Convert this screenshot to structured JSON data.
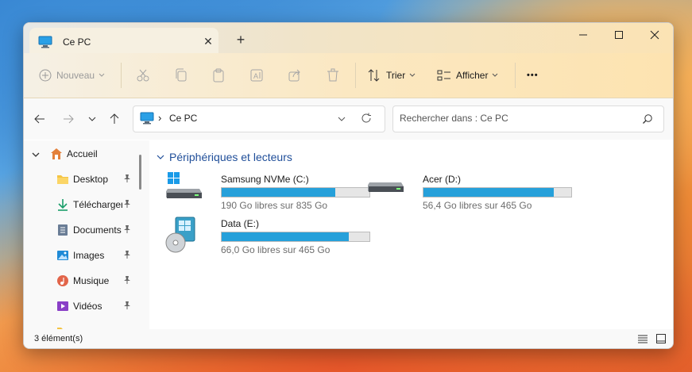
{
  "window": {
    "tab_title": "Ce PC",
    "new_tab": "+",
    "close_tab": "✕"
  },
  "toolbar": {
    "new_label": "Nouveau",
    "sort_label": "Trier",
    "view_label": "Afficher",
    "more_label": "•••"
  },
  "nav": {
    "breadcrumb_sep": "›",
    "location": "Ce PC",
    "search_placeholder": "Rechercher dans : Ce PC"
  },
  "sidebar": {
    "items": [
      {
        "label": "Accueil",
        "icon": "home-icon"
      },
      {
        "label": "Desktop",
        "icon": "folder-icon",
        "pinned": true
      },
      {
        "label": "Télécharger",
        "icon": "download-icon",
        "pinned": true
      },
      {
        "label": "Documents",
        "icon": "documents-icon",
        "pinned": true
      },
      {
        "label": "Images",
        "icon": "images-icon",
        "pinned": true
      },
      {
        "label": "Musique",
        "icon": "music-icon",
        "pinned": true
      },
      {
        "label": "Vidéos",
        "icon": "videos-icon",
        "pinned": true
      }
    ]
  },
  "main": {
    "section_title": "Périphériques et lecteurs",
    "drives": [
      {
        "name": "Samsung NVMe (C:)",
        "free": "190 Go libres sur 835 Go",
        "used_fraction": 0.77,
        "icon": "windows-drive-icon"
      },
      {
        "name": "Acer (D:)",
        "free": "56,4 Go libres sur 465 Go",
        "used_fraction": 0.88,
        "icon": "drive-icon"
      },
      {
        "name": "Data (E:)",
        "free": "66,0 Go libres sur 465 Go",
        "used_fraction": 0.86,
        "icon": "disc-drive-icon"
      }
    ]
  },
  "status": {
    "item_count": "3 élément(s)"
  },
  "colors": {
    "accent": "#26a0da",
    "section_title": "#1f4e99"
  }
}
